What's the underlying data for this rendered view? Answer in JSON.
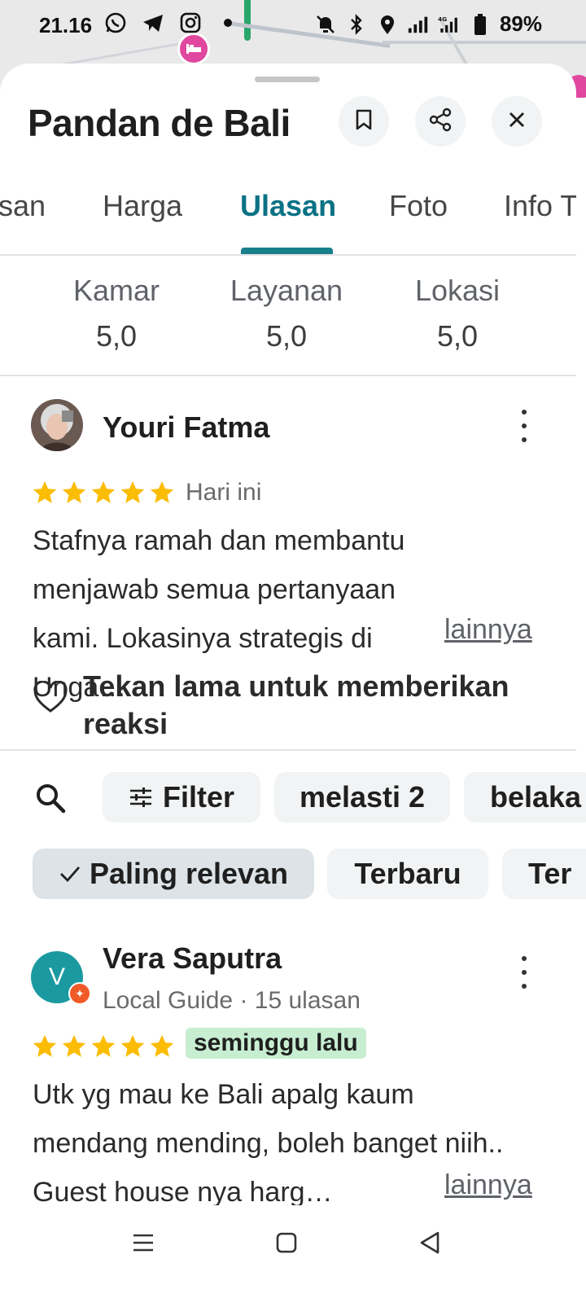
{
  "status_bar": {
    "time": "21.16",
    "battery": "89%",
    "left_icons": [
      "whatsapp-icon",
      "telegram-icon",
      "instagram-icon",
      "dot-icon"
    ],
    "right_icons": [
      "mute-icon",
      "bluetooth-icon",
      "location-icon",
      "signal-icon",
      "4g-signal-icon",
      "battery-icon"
    ]
  },
  "place": {
    "title": "Pandan de Bali"
  },
  "header_buttons": [
    "bookmark-icon",
    "share-icon",
    "close-icon"
  ],
  "tabs": [
    {
      "label": "san",
      "active": false
    },
    {
      "label": "Harga",
      "active": false
    },
    {
      "label": "Ulasan",
      "active": true
    },
    {
      "label": "Foto",
      "active": false
    },
    {
      "label": "Info T",
      "active": false
    }
  ],
  "ratings": [
    {
      "label": "Kamar",
      "value": "5,0"
    },
    {
      "label": "Layanan",
      "value": "5,0"
    },
    {
      "label": "Lokasi",
      "value": "5,0"
    }
  ],
  "review1": {
    "author": "Youri Fatma",
    "stars": 5,
    "date": "Hari ini",
    "text": "Stafnya ramah dan membantu menjawab semua pertanyaan kami. Lokasinya strategis di Unga…",
    "more": "lainnya",
    "reaction": "Tekan lama untuk memberikan reaksi"
  },
  "filters": {
    "search_icon": "search-icon",
    "chips": [
      "Filter",
      "melasti 2",
      "belaka"
    ],
    "sort": [
      {
        "label": "Paling relevan",
        "selected": true
      },
      {
        "label": "Terbaru",
        "selected": false
      },
      {
        "label": "Ter",
        "selected": false
      }
    ]
  },
  "review2": {
    "author": "Vera Saputra",
    "initial": "V",
    "meta": "Local Guide · 15 ulasan",
    "stars": 5,
    "date": "seminggu lalu",
    "text": "Utk yg mau ke Bali apalg kaum mendang mending, boleh banget niih.. Guest house nya harg…",
    "more": "lainnya"
  },
  "nav": [
    "recents-icon",
    "home-icon",
    "back-icon"
  ],
  "colors": {
    "accent": "#0b7285",
    "star": "#fbbc04",
    "pin": "#e0479e",
    "avatar_v": "#1a9aa0",
    "highlight": "#c8eed1"
  }
}
